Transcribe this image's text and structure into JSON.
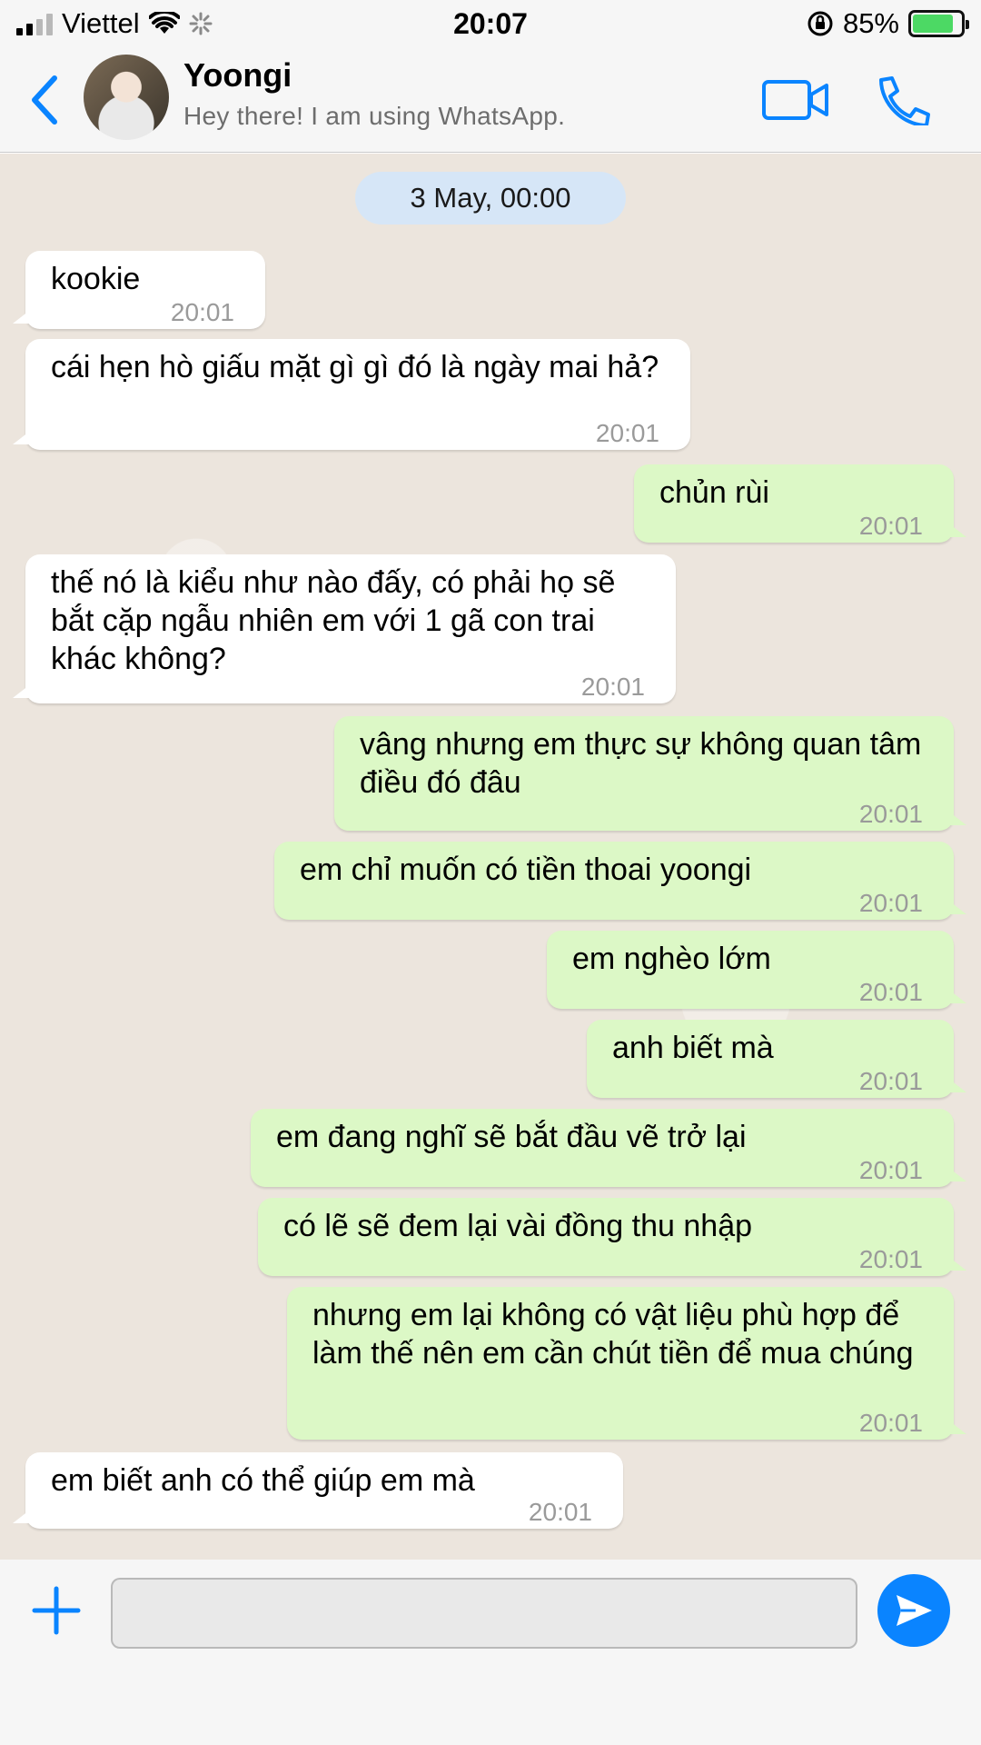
{
  "status_bar": {
    "carrier": "Viettel",
    "time": "20:07",
    "battery_percent": "85%",
    "battery_level": 0.85
  },
  "header": {
    "contact_name": "Yoongi",
    "contact_status": "Hey there! I am using WhatsApp."
  },
  "chat": {
    "date_label": "3 May, 00:00",
    "messages": [
      {
        "direction": "in",
        "text": "kookie",
        "time": "20:01"
      },
      {
        "direction": "in",
        "text": "cái hẹn hò giấu mặt gì gì đó là ngày mai hả?",
        "time": "20:01"
      },
      {
        "direction": "out",
        "text": "chủn rùi",
        "time": "20:01"
      },
      {
        "direction": "in",
        "text": "thế nó là kiểu như nào đấy, có phải họ sẽ bắt cặp ngẫu nhiên em với 1 gã con trai khác không?",
        "time": "20:01"
      },
      {
        "direction": "out",
        "text": "vâng nhưng em thực sự không quan tâm điều đó đâu",
        "time": "20:01"
      },
      {
        "direction": "out",
        "text": "em chỉ muốn có tiền thoai yoongi",
        "time": "20:01"
      },
      {
        "direction": "out",
        "text": "em nghèo lớm",
        "time": "20:01"
      },
      {
        "direction": "out",
        "text": "anh biết mà",
        "time": "20:01"
      },
      {
        "direction": "out",
        "text": "em đang nghĩ sẽ bắt đầu vẽ trở lại",
        "time": "20:01"
      },
      {
        "direction": "out",
        "text": "có lẽ sẽ đem lại vài đồng thu nhập",
        "time": "20:01"
      },
      {
        "direction": "out",
        "text": "nhưng em lại không có vật liệu phù hợp để làm thế nên em cần chút tiền để mua chúng",
        "time": "20:01"
      },
      {
        "direction": "in",
        "text": "em biết anh có thể giúp em mà",
        "time": "20:01"
      }
    ]
  },
  "input_bar": {
    "message_value": "",
    "placeholder": ""
  },
  "colors": {
    "accent": "#0a84ff",
    "outgoing_bubble": "#dcf8c6",
    "incoming_bubble": "#ffffff",
    "date_pill": "#d6e6f7",
    "chat_background": "#ece5dd",
    "battery_fill": "#4cd964"
  },
  "icons": [
    "signal-icon",
    "wifi-icon",
    "loading-icon",
    "orientation-lock-icon",
    "battery-icon",
    "back-chevron-icon",
    "video-call-icon",
    "phone-icon",
    "plus-icon",
    "send-icon"
  ]
}
